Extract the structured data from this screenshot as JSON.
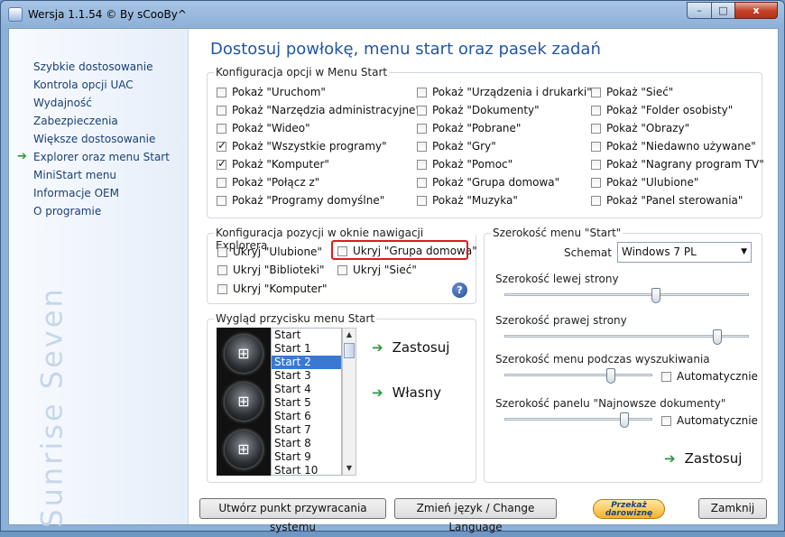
{
  "window": {
    "title": "Wersja 1.1.54 © By sCooBy^",
    "min_label": "–",
    "max_label": "□",
    "close_label": "x"
  },
  "sidebar": {
    "items": [
      {
        "label": "Szybkie dostosowanie"
      },
      {
        "label": "Kontrola opcji UAC"
      },
      {
        "label": "Wydajność"
      },
      {
        "label": "Zabezpieczenia"
      },
      {
        "label": "Większe dostosowanie"
      },
      {
        "label": "Explorer oraz menu Start",
        "active": true
      },
      {
        "label": "MiniStart menu"
      },
      {
        "label": "Informacje OEM"
      },
      {
        "label": "O programie"
      }
    ],
    "active_arrow": "➔",
    "brand": "Sunrise Seven"
  },
  "main": {
    "heading": "Dostosuj powłokę, menu start oraz pasek zadań"
  },
  "start_menu_options": {
    "legend": "Konfiguracja opcji w Menu Start",
    "columns": [
      [
        {
          "label": "Pokaż \"Uruchom\"",
          "checked": false
        },
        {
          "label": "Pokaż \"Narzędzia administracyjne\"",
          "checked": false
        },
        {
          "label": "Pokaż \"Wideo\"",
          "checked": false
        },
        {
          "label": "Pokaż \"Wszystkie programy\"",
          "checked": true
        },
        {
          "label": "Pokaż \"Komputer\"",
          "checked": true
        },
        {
          "label": "Pokaż \"Połącz z\"",
          "checked": false
        },
        {
          "label": "Pokaż \"Programy domyślne\"",
          "checked": false
        }
      ],
      [
        {
          "label": "Pokaż \"Urządzenia i drukarki\"",
          "checked": false
        },
        {
          "label": "Pokaż \"Dokumenty\"",
          "checked": false
        },
        {
          "label": "Pokaż \"Pobrane\"",
          "checked": false
        },
        {
          "label": "Pokaż \"Gry\"",
          "checked": false
        },
        {
          "label": "Pokaż \"Pomoc\"",
          "checked": false
        },
        {
          "label": "Pokaż \"Grupa domowa\"",
          "checked": false
        },
        {
          "label": "Pokaż \"Muzyka\"",
          "checked": false
        }
      ],
      [
        {
          "label": "Pokaż \"Sieć\"",
          "checked": false
        },
        {
          "label": "Pokaż \"Folder osobisty\"",
          "checked": false
        },
        {
          "label": "Pokaż \"Obrazy\"",
          "checked": false
        },
        {
          "label": "Pokaż \"Niedawno używane\"",
          "checked": false
        },
        {
          "label": "Pokaż \"Nagrany program TV\"",
          "checked": false
        },
        {
          "label": "Pokaż \"Ulubione\"",
          "checked": false
        },
        {
          "label": "Pokaż \"Panel sterowania\"",
          "checked": false
        }
      ]
    ]
  },
  "explorer_nav": {
    "legend": "Konfiguracja pozycji w oknie nawigacji Explorera",
    "items": [
      {
        "label": "Ukryj \"Ulubione\"",
        "checked": false
      },
      {
        "label": "Ukryj \"Grupa domowa\"",
        "checked": false,
        "highlighted": true
      },
      {
        "label": "Ukryj \"Biblioteki\"",
        "checked": false
      },
      {
        "label": "Ukryj  \"Sieć\"",
        "checked": false
      },
      {
        "label": "Ukryj \"Komputer\"",
        "checked": false
      }
    ],
    "help_label": "?"
  },
  "start_button": {
    "legend": "Wygląd przycisku menu Start",
    "orb_glyph": "⊞",
    "items": [
      "Start",
      "Start 1",
      "Start 2",
      "Start 3",
      "Start 4",
      "Start 5",
      "Start 6",
      "Start 7",
      "Start 8",
      "Start 9",
      "Start 10"
    ],
    "selected": "Start 2",
    "scroll_up": "▲",
    "scroll_down": "▼",
    "apply_label": "Zastosuj",
    "custom_label": "Własny",
    "action_arrow": "➔"
  },
  "start_width": {
    "legend": "Szerokość menu \"Start\"",
    "scheme_label": "Schemat",
    "scheme_value": "Windows 7 PL",
    "dropdown_arrow": "▼",
    "left_label": "Szerokość lewej strony",
    "left_value": 0.62,
    "right_label": "Szerokość prawej strony",
    "right_value": 0.87,
    "search_label": "Szerokość menu podczas wyszukiwania",
    "search_value": 0.72,
    "search_auto_label": "Automatycznie",
    "search_auto_checked": false,
    "recent_label": "Szerokość panelu \"Najnowsze dokumenty\"",
    "recent_value": 0.81,
    "recent_auto_label": "Automatycznie",
    "recent_auto_checked": false,
    "apply_label": "Zastosuj"
  },
  "footer": {
    "restore_label": "Utwórz punkt przywracania systemu",
    "language_label": "Zmień język / Change Language",
    "donate_line1": "Przekaż",
    "donate_line2": "darowiznę",
    "close_label": "Zamknij"
  },
  "colors": {
    "heading": "#2356a0",
    "accent_arrow": "#2a9a3a",
    "highlight": "#d71f1f",
    "selection": "#3a78d4"
  }
}
